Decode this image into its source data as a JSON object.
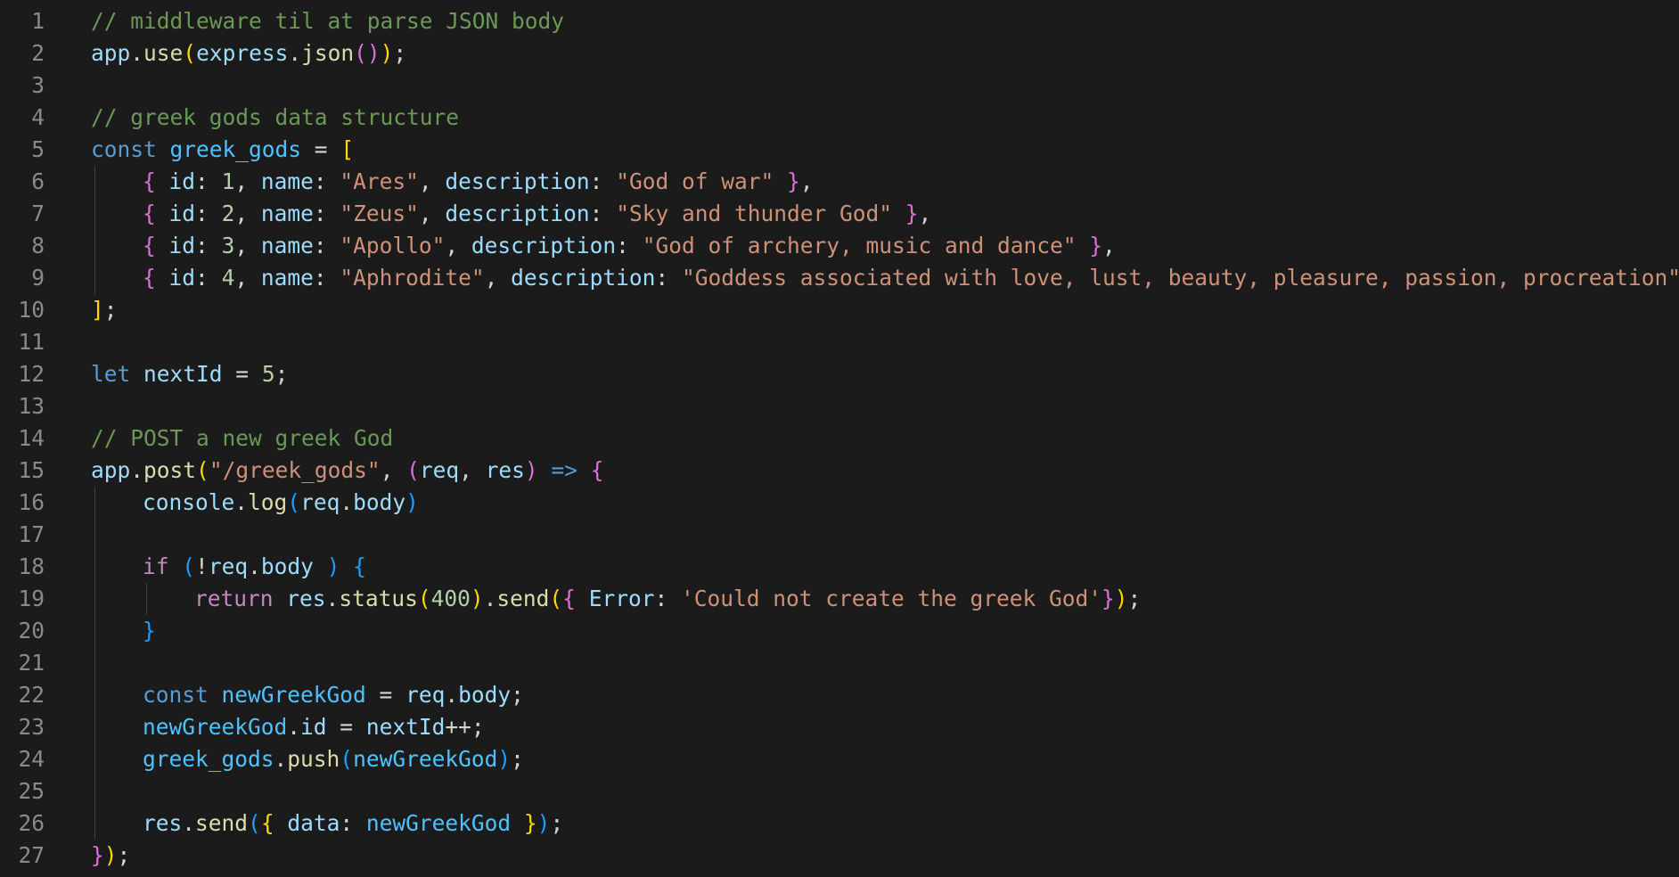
{
  "editor": {
    "theme_colors": {
      "background": "#1b1b1b",
      "line_number": "#8a8a8a",
      "comment": "#6a9955",
      "variable": "#9cdcfe",
      "function": "#dcdcaa",
      "string": "#ce9178",
      "number": "#b5cea8",
      "keyword": "#569cd6",
      "control_keyword": "#c586c0",
      "constant": "#4fc1ff",
      "bracket_level_1": "#ffd700",
      "bracket_level_2": "#da70d6",
      "bracket_level_3": "#179fff"
    },
    "lines": [
      {
        "number": "1",
        "indent": 0,
        "tokens": [
          {
            "t": "// middleware til at parse JSON body",
            "c": "comment"
          }
        ]
      },
      {
        "number": "2",
        "indent": 0,
        "tokens": [
          {
            "t": "app",
            "c": "var"
          },
          {
            "t": ".",
            "c": "plain"
          },
          {
            "t": "use",
            "c": "fn"
          },
          {
            "t": "(",
            "c": "b1"
          },
          {
            "t": "express",
            "c": "var"
          },
          {
            "t": ".",
            "c": "plain"
          },
          {
            "t": "json",
            "c": "fn"
          },
          {
            "t": "()",
            "c": "b2"
          },
          {
            "t": ")",
            "c": "b1"
          },
          {
            "t": ";",
            "c": "plain"
          }
        ]
      },
      {
        "number": "3",
        "indent": 0,
        "tokens": []
      },
      {
        "number": "4",
        "indent": 0,
        "tokens": [
          {
            "t": "// greek gods data structure",
            "c": "comment"
          }
        ]
      },
      {
        "number": "5",
        "indent": 0,
        "tokens": [
          {
            "t": "const",
            "c": "kw"
          },
          {
            "t": " ",
            "c": "plain"
          },
          {
            "t": "greek_gods",
            "c": "const"
          },
          {
            "t": " = ",
            "c": "plain"
          },
          {
            "t": "[",
            "c": "b1"
          }
        ]
      },
      {
        "number": "6",
        "indent": 1,
        "tokens": [
          {
            "t": "{",
            "c": "b2"
          },
          {
            "t": " ",
            "c": "plain"
          },
          {
            "t": "id",
            "c": "var"
          },
          {
            "t": ": ",
            "c": "plain"
          },
          {
            "t": "1",
            "c": "num"
          },
          {
            "t": ", ",
            "c": "plain"
          },
          {
            "t": "name",
            "c": "var"
          },
          {
            "t": ": ",
            "c": "plain"
          },
          {
            "t": "\"Ares\"",
            "c": "str"
          },
          {
            "t": ", ",
            "c": "plain"
          },
          {
            "t": "description",
            "c": "var"
          },
          {
            "t": ": ",
            "c": "plain"
          },
          {
            "t": "\"God of war\"",
            "c": "str"
          },
          {
            "t": " ",
            "c": "plain"
          },
          {
            "t": "}",
            "c": "b2"
          },
          {
            "t": ",",
            "c": "plain"
          }
        ]
      },
      {
        "number": "7",
        "indent": 1,
        "tokens": [
          {
            "t": "{",
            "c": "b2"
          },
          {
            "t": " ",
            "c": "plain"
          },
          {
            "t": "id",
            "c": "var"
          },
          {
            "t": ": ",
            "c": "plain"
          },
          {
            "t": "2",
            "c": "num"
          },
          {
            "t": ", ",
            "c": "plain"
          },
          {
            "t": "name",
            "c": "var"
          },
          {
            "t": ": ",
            "c": "plain"
          },
          {
            "t": "\"Zeus\"",
            "c": "str"
          },
          {
            "t": ", ",
            "c": "plain"
          },
          {
            "t": "description",
            "c": "var"
          },
          {
            "t": ": ",
            "c": "plain"
          },
          {
            "t": "\"Sky and thunder God\"",
            "c": "str"
          },
          {
            "t": " ",
            "c": "plain"
          },
          {
            "t": "}",
            "c": "b2"
          },
          {
            "t": ",",
            "c": "plain"
          }
        ]
      },
      {
        "number": "8",
        "indent": 1,
        "tokens": [
          {
            "t": "{",
            "c": "b2"
          },
          {
            "t": " ",
            "c": "plain"
          },
          {
            "t": "id",
            "c": "var"
          },
          {
            "t": ": ",
            "c": "plain"
          },
          {
            "t": "3",
            "c": "num"
          },
          {
            "t": ", ",
            "c": "plain"
          },
          {
            "t": "name",
            "c": "var"
          },
          {
            "t": ": ",
            "c": "plain"
          },
          {
            "t": "\"Apollo\"",
            "c": "str"
          },
          {
            "t": ", ",
            "c": "plain"
          },
          {
            "t": "description",
            "c": "var"
          },
          {
            "t": ": ",
            "c": "plain"
          },
          {
            "t": "\"God of archery, music and dance\"",
            "c": "str"
          },
          {
            "t": " ",
            "c": "plain"
          },
          {
            "t": "}",
            "c": "b2"
          },
          {
            "t": ",",
            "c": "plain"
          }
        ]
      },
      {
        "number": "9",
        "indent": 1,
        "tokens": [
          {
            "t": "{",
            "c": "b2"
          },
          {
            "t": " ",
            "c": "plain"
          },
          {
            "t": "id",
            "c": "var"
          },
          {
            "t": ": ",
            "c": "plain"
          },
          {
            "t": "4",
            "c": "num"
          },
          {
            "t": ", ",
            "c": "plain"
          },
          {
            "t": "name",
            "c": "var"
          },
          {
            "t": ": ",
            "c": "plain"
          },
          {
            "t": "\"Aphrodite\"",
            "c": "str"
          },
          {
            "t": ", ",
            "c": "plain"
          },
          {
            "t": "description",
            "c": "var"
          },
          {
            "t": ": ",
            "c": "plain"
          },
          {
            "t": "\"Goddess associated with love, lust, beauty, pleasure, passion, procreation\"",
            "c": "str"
          },
          {
            "t": "}",
            "c": "b2"
          }
        ]
      },
      {
        "number": "10",
        "indent": 0,
        "tokens": [
          {
            "t": "]",
            "c": "b1"
          },
          {
            "t": ";",
            "c": "plain"
          }
        ]
      },
      {
        "number": "11",
        "indent": 0,
        "tokens": []
      },
      {
        "number": "12",
        "indent": 0,
        "tokens": [
          {
            "t": "let",
            "c": "kw"
          },
          {
            "t": " ",
            "c": "plain"
          },
          {
            "t": "nextId",
            "c": "var"
          },
          {
            "t": " = ",
            "c": "plain"
          },
          {
            "t": "5",
            "c": "num"
          },
          {
            "t": ";",
            "c": "plain"
          }
        ]
      },
      {
        "number": "13",
        "indent": 0,
        "tokens": []
      },
      {
        "number": "14",
        "indent": 0,
        "tokens": [
          {
            "t": "// POST a new greek God",
            "c": "comment"
          }
        ]
      },
      {
        "number": "15",
        "indent": 0,
        "tokens": [
          {
            "t": "app",
            "c": "var"
          },
          {
            "t": ".",
            "c": "plain"
          },
          {
            "t": "post",
            "c": "fn"
          },
          {
            "t": "(",
            "c": "b1"
          },
          {
            "t": "\"/greek_gods\"",
            "c": "str"
          },
          {
            "t": ", ",
            "c": "plain"
          },
          {
            "t": "(",
            "c": "b2"
          },
          {
            "t": "req",
            "c": "var"
          },
          {
            "t": ", ",
            "c": "plain"
          },
          {
            "t": "res",
            "c": "var"
          },
          {
            "t": ")",
            "c": "b2"
          },
          {
            "t": " ",
            "c": "plain"
          },
          {
            "t": "=>",
            "c": "kw"
          },
          {
            "t": " ",
            "c": "plain"
          },
          {
            "t": "{",
            "c": "b2"
          }
        ]
      },
      {
        "number": "16",
        "indent": 1,
        "tokens": [
          {
            "t": "console",
            "c": "var"
          },
          {
            "t": ".",
            "c": "plain"
          },
          {
            "t": "log",
            "c": "fn"
          },
          {
            "t": "(",
            "c": "b3"
          },
          {
            "t": "req",
            "c": "var"
          },
          {
            "t": ".",
            "c": "plain"
          },
          {
            "t": "body",
            "c": "var"
          },
          {
            "t": ")",
            "c": "b3"
          }
        ]
      },
      {
        "number": "17",
        "indent": 1,
        "tokens": []
      },
      {
        "number": "18",
        "indent": 1,
        "tokens": [
          {
            "t": "if",
            "c": "ctrl"
          },
          {
            "t": " ",
            "c": "plain"
          },
          {
            "t": "(",
            "c": "b3"
          },
          {
            "t": "!",
            "c": "plain"
          },
          {
            "t": "req",
            "c": "var"
          },
          {
            "t": ".",
            "c": "plain"
          },
          {
            "t": "body",
            "c": "var"
          },
          {
            "t": " ",
            "c": "plain"
          },
          {
            "t": ")",
            "c": "b3"
          },
          {
            "t": " ",
            "c": "plain"
          },
          {
            "t": "{",
            "c": "b3"
          }
        ]
      },
      {
        "number": "19",
        "indent": 2,
        "tokens": [
          {
            "t": "return",
            "c": "ctrl"
          },
          {
            "t": " ",
            "c": "plain"
          },
          {
            "t": "res",
            "c": "var"
          },
          {
            "t": ".",
            "c": "plain"
          },
          {
            "t": "status",
            "c": "fn"
          },
          {
            "t": "(",
            "c": "b1"
          },
          {
            "t": "400",
            "c": "num"
          },
          {
            "t": ")",
            "c": "b1"
          },
          {
            "t": ".",
            "c": "plain"
          },
          {
            "t": "send",
            "c": "fn"
          },
          {
            "t": "(",
            "c": "b1"
          },
          {
            "t": "{",
            "c": "b2"
          },
          {
            "t": " ",
            "c": "plain"
          },
          {
            "t": "Error",
            "c": "var"
          },
          {
            "t": ": ",
            "c": "plain"
          },
          {
            "t": "'Could not create the greek God'",
            "c": "str"
          },
          {
            "t": "}",
            "c": "b2"
          },
          {
            "t": ")",
            "c": "b1"
          },
          {
            "t": ";",
            "c": "plain"
          }
        ]
      },
      {
        "number": "20",
        "indent": 1,
        "tokens": [
          {
            "t": "}",
            "c": "b3"
          }
        ]
      },
      {
        "number": "21",
        "indent": 1,
        "tokens": []
      },
      {
        "number": "22",
        "indent": 1,
        "tokens": [
          {
            "t": "const",
            "c": "kw"
          },
          {
            "t": " ",
            "c": "plain"
          },
          {
            "t": "newGreekGod",
            "c": "const"
          },
          {
            "t": " = ",
            "c": "plain"
          },
          {
            "t": "req",
            "c": "var"
          },
          {
            "t": ".",
            "c": "plain"
          },
          {
            "t": "body",
            "c": "var"
          },
          {
            "t": ";",
            "c": "plain"
          }
        ]
      },
      {
        "number": "23",
        "indent": 1,
        "tokens": [
          {
            "t": "newGreekGod",
            "c": "const"
          },
          {
            "t": ".",
            "c": "plain"
          },
          {
            "t": "id",
            "c": "var"
          },
          {
            "t": " = ",
            "c": "plain"
          },
          {
            "t": "nextId",
            "c": "var"
          },
          {
            "t": "++;",
            "c": "plain"
          }
        ]
      },
      {
        "number": "24",
        "indent": 1,
        "tokens": [
          {
            "t": "greek_gods",
            "c": "const"
          },
          {
            "t": ".",
            "c": "plain"
          },
          {
            "t": "push",
            "c": "fn"
          },
          {
            "t": "(",
            "c": "b3"
          },
          {
            "t": "newGreekGod",
            "c": "const"
          },
          {
            "t": ")",
            "c": "b3"
          },
          {
            "t": ";",
            "c": "plain"
          }
        ]
      },
      {
        "number": "25",
        "indent": 1,
        "tokens": []
      },
      {
        "number": "26",
        "indent": 1,
        "tokens": [
          {
            "t": "res",
            "c": "var"
          },
          {
            "t": ".",
            "c": "plain"
          },
          {
            "t": "send",
            "c": "fn"
          },
          {
            "t": "(",
            "c": "b3"
          },
          {
            "t": "{",
            "c": "b1"
          },
          {
            "t": " ",
            "c": "plain"
          },
          {
            "t": "data",
            "c": "var"
          },
          {
            "t": ": ",
            "c": "plain"
          },
          {
            "t": "newGreekGod",
            "c": "const"
          },
          {
            "t": " ",
            "c": "plain"
          },
          {
            "t": "}",
            "c": "b1"
          },
          {
            "t": ")",
            "c": "b3"
          },
          {
            "t": ";",
            "c": "plain"
          }
        ]
      },
      {
        "number": "27",
        "indent": 0,
        "tokens": [
          {
            "t": "}",
            "c": "b2"
          },
          {
            "t": ")",
            "c": "b1"
          },
          {
            "t": ";",
            "c": "plain"
          }
        ]
      }
    ]
  }
}
